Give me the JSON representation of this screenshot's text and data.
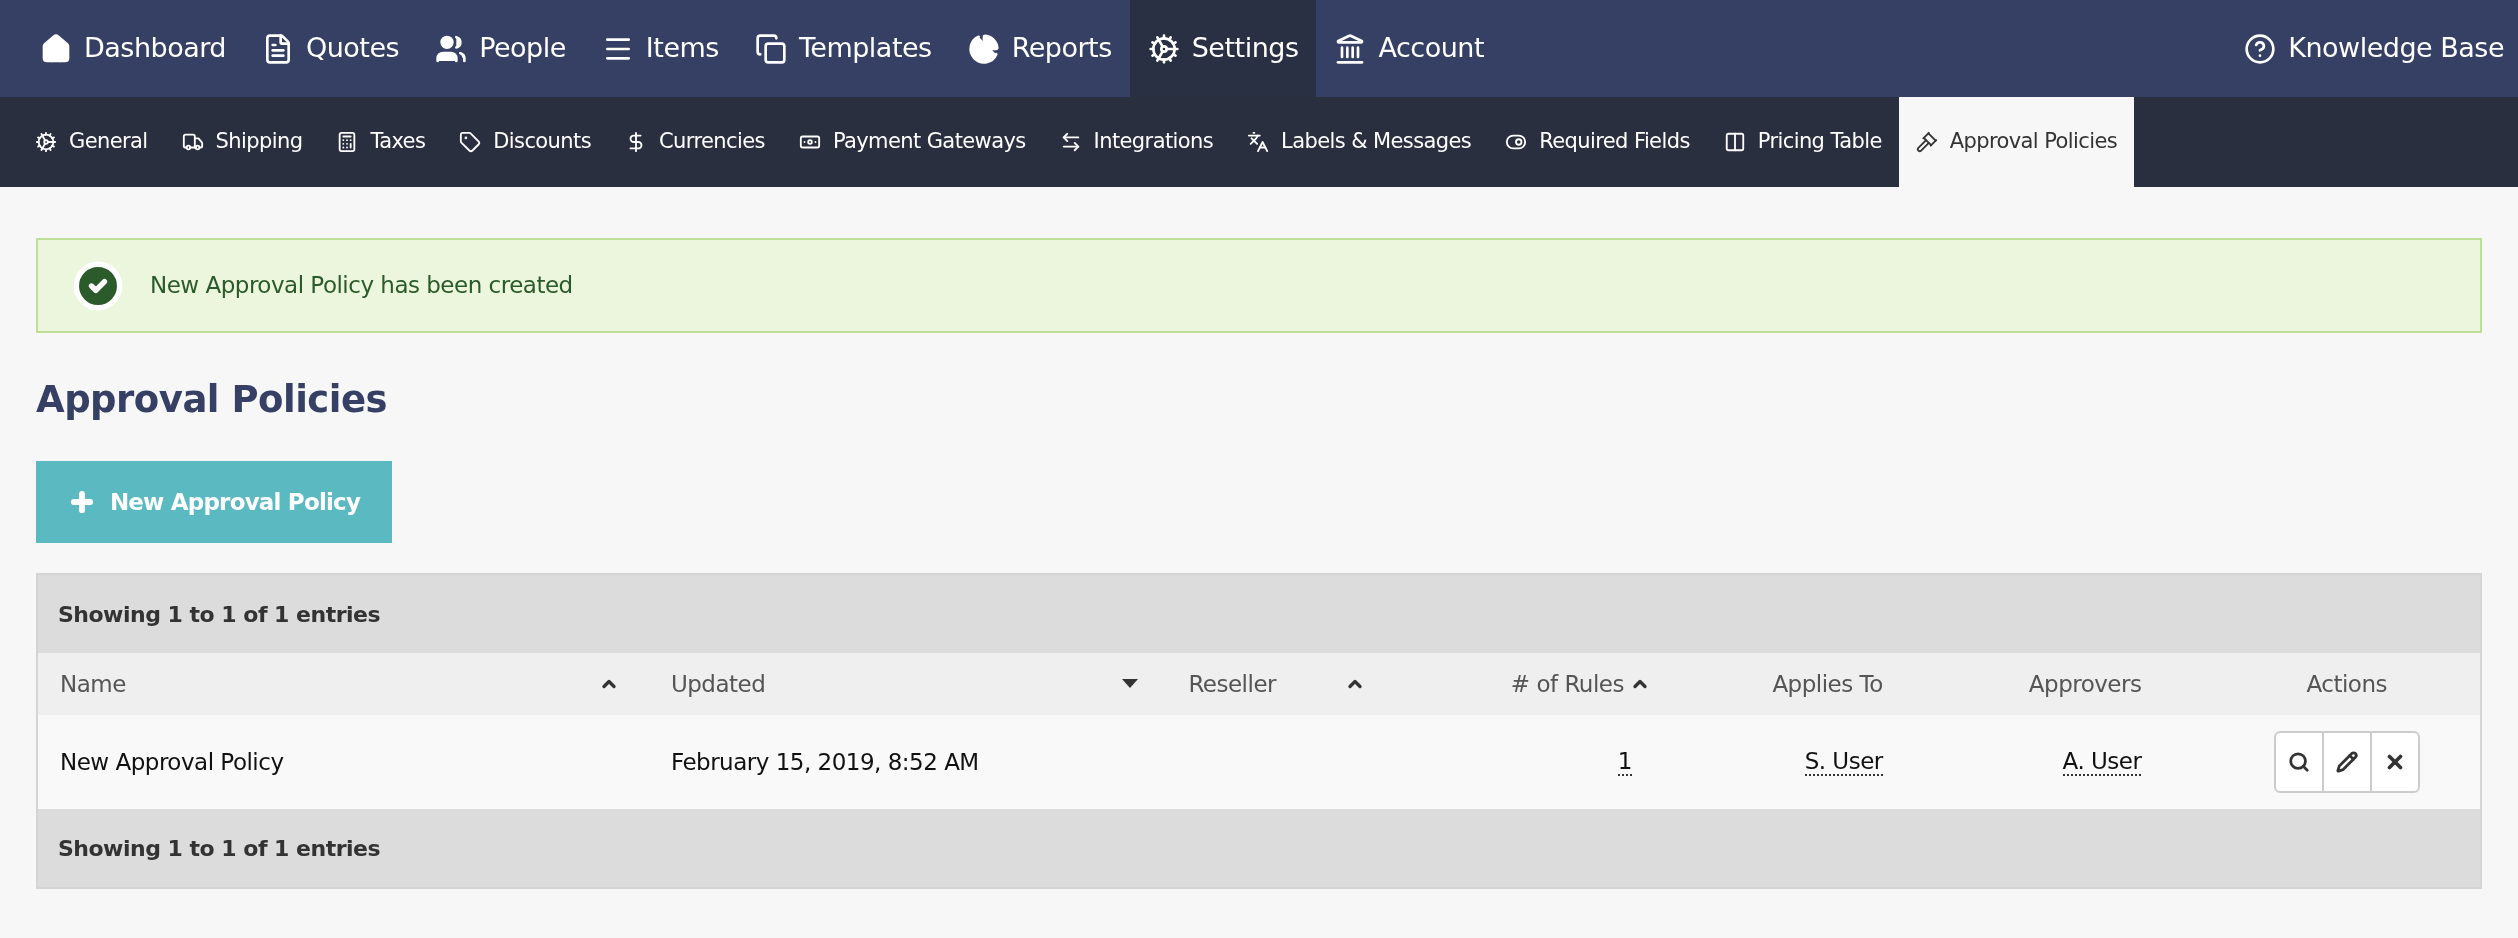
{
  "top_nav": {
    "items": [
      {
        "label": "Dashboard",
        "selected": false
      },
      {
        "label": "Quotes",
        "selected": false
      },
      {
        "label": "People",
        "selected": false
      },
      {
        "label": "Items",
        "selected": false
      },
      {
        "label": "Templates",
        "selected": false
      },
      {
        "label": "Reports",
        "selected": false
      },
      {
        "label": "Settings",
        "selected": true
      },
      {
        "label": "Account",
        "selected": false
      }
    ],
    "help_link": "Knowledge Base"
  },
  "sub_nav": {
    "items": [
      {
        "label": "General",
        "selected": false
      },
      {
        "label": "Shipping",
        "selected": false
      },
      {
        "label": "Taxes",
        "selected": false
      },
      {
        "label": "Discounts",
        "selected": false
      },
      {
        "label": "Currencies",
        "selected": false
      },
      {
        "label": "Payment Gateways",
        "selected": false
      },
      {
        "label": "Integrations",
        "selected": false
      },
      {
        "label": "Labels & Messages",
        "selected": false
      },
      {
        "label": "Required Fields",
        "selected": false
      },
      {
        "label": "Pricing Table",
        "selected": false
      },
      {
        "label": "Approval Policies",
        "selected": true
      }
    ]
  },
  "alert": {
    "message": "New Approval Policy has been created"
  },
  "page_title": "Approval Policies",
  "new_button": "New Approval Policy",
  "table": {
    "summary_top": "Showing 1 to 1 of 1 entries",
    "columns": [
      {
        "label": "Name",
        "sorted": false
      },
      {
        "label": "Updated",
        "sorted": true
      },
      {
        "label": "Reseller",
        "sorted": false
      },
      {
        "label": "# of Rules",
        "sorted": false
      },
      {
        "label": "Applies To"
      },
      {
        "label": "Approvers"
      },
      {
        "label": "Actions"
      }
    ],
    "rows": [
      {
        "name": "New Approval Policy",
        "updated": "February 15, 2019, 8:52 AM",
        "rules": "1",
        "applies_to": "S. User",
        "approvers": "A. User"
      }
    ],
    "summary_bottom": "Showing 1 to 1 of 1 entries"
  }
}
